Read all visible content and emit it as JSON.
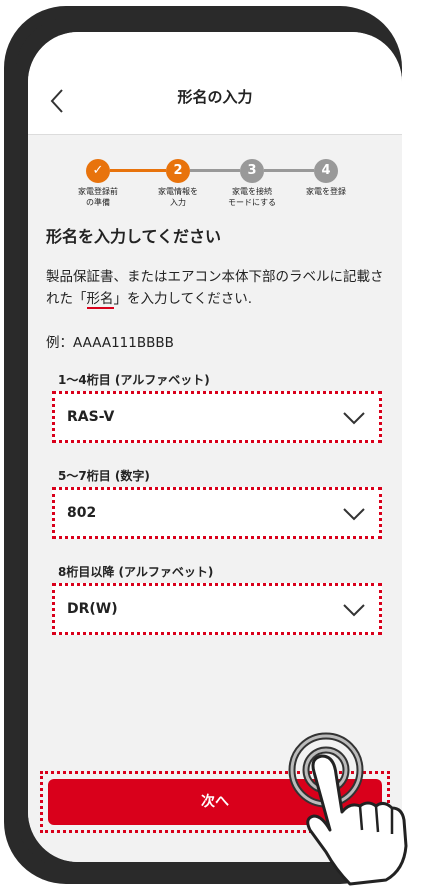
{
  "header": {
    "title": "形名の入力"
  },
  "steps": [
    {
      "number": "✓",
      "label_line1": "家電登録前",
      "label_line2": "の準備",
      "state": "done"
    },
    {
      "number": "2",
      "label_line1": "家電情報を",
      "label_line2": "入力",
      "state": "current"
    },
    {
      "number": "3",
      "label_line1": "家電を接続",
      "label_line2": "モードにする",
      "state": "todo"
    },
    {
      "number": "4",
      "label_line1": "家電を登録",
      "label_line2": "",
      "state": "todo"
    }
  ],
  "main": {
    "heading": "形名を入力してください",
    "desc_part1": "製品保証書、またはエアコン本体下部のラベルに記載された「",
    "desc_keyword": "形名",
    "desc_part2": "」を入力してください.",
    "example": "例：AAAA111BBBB"
  },
  "fields": [
    {
      "label": "1～4桁目 (アルファベット)",
      "value": "RAS-V"
    },
    {
      "label": "5～7桁目 (数字)",
      "value": "802"
    },
    {
      "label": "8桁目以降 (アルファベット)",
      "value": "DR(W)"
    }
  ],
  "footer": {
    "next_label": "次へ"
  },
  "colors": {
    "accent": "#d9001b",
    "step_done": "#e8730c",
    "step_todo": "#999999"
  },
  "icons": {
    "back": "chevron-left-icon",
    "select": "chevron-down-icon",
    "pointer": "tap-hand-icon"
  }
}
